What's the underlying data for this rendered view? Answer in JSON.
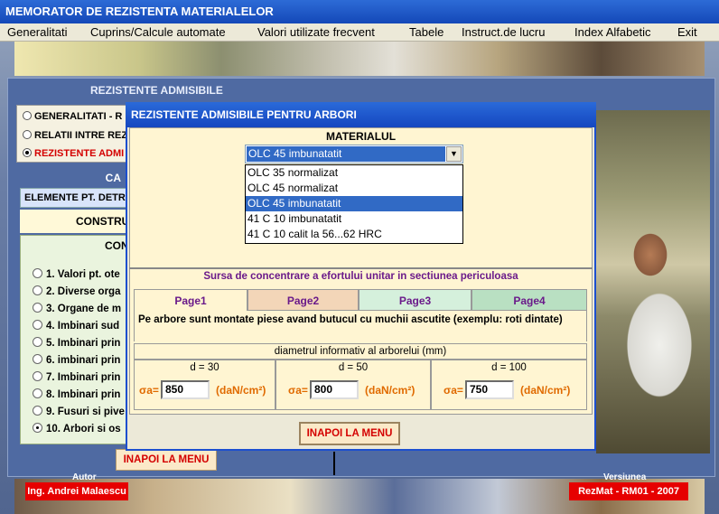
{
  "app": {
    "title": "MEMORATOR DE REZISTENTA MATERIALELOR"
  },
  "menu": [
    "Generalitati",
    "Cuprins/Calcule automate",
    "Valori utilizate frecvent",
    "Tabele",
    "Instruct.de lucru",
    "Index Alfabetic",
    "Exit"
  ],
  "back_window": {
    "title": "REZISTENTE ADMISIBILE",
    "radios": [
      "GENERALITATI - R",
      "RELATII INTRE REZI",
      "REZISTENTE ADMI"
    ],
    "calc_head": "CA",
    "elem_bar": "ELEMENTE PT. DETR",
    "constr": "CONSTRU",
    "con": "CON",
    "list": [
      "1. Valori pt. ote",
      "2. Diverse orga",
      "3. Organe de m",
      "4. Imbinari sud",
      "5. Imbinari prin",
      "6. imbinari prin",
      "7. Imbinari prin",
      "8. Imbinari prin",
      "9. Fusuri si pive",
      "10. Arbori si os"
    ],
    "back_button": "INAPOI LA MENU",
    "author_caption": "Autor",
    "author": "Ing. Andrei Malaescu",
    "version_caption": "Versiunea",
    "version": "RezMat - RM01 - 2007"
  },
  "dialog": {
    "title": "REZISTENTE ADMISIBILE PENTRU ARBORI",
    "material_label": "MATERIALUL",
    "material_selected": "OLC  45 imbunatatit",
    "material_options": [
      "OLC 35 normalizat",
      "OLC 45 normalizat",
      "OLC  45 imbunatatit",
      "41 C 10 imbunatatit",
      "41 C 10 calit la 56...62 HRC"
    ],
    "sursa": "Sursa de concentrare a efortului unitar in sectiunea periculoasa",
    "tabs": [
      "Page1",
      "Page2",
      "Page3",
      "Page4"
    ],
    "tab_text": "Pe arbore sunt montate piese avand butucul cu muchii ascutite (exemplu: roti dintate)",
    "diam_label": "diametrul informativ al arborelui (mm)",
    "columns": [
      {
        "d": "d = 30",
        "sigma": "σa=",
        "value": "850",
        "unit": "(daN/cm²)"
      },
      {
        "d": "d = 50",
        "sigma": "σa=",
        "value": "800",
        "unit": "(daN/cm²)"
      },
      {
        "d": "d = 100",
        "sigma": "σa=",
        "value": "750",
        "unit": "(daN/cm²)"
      }
    ],
    "back_button": "INAPOI LA MENU"
  }
}
